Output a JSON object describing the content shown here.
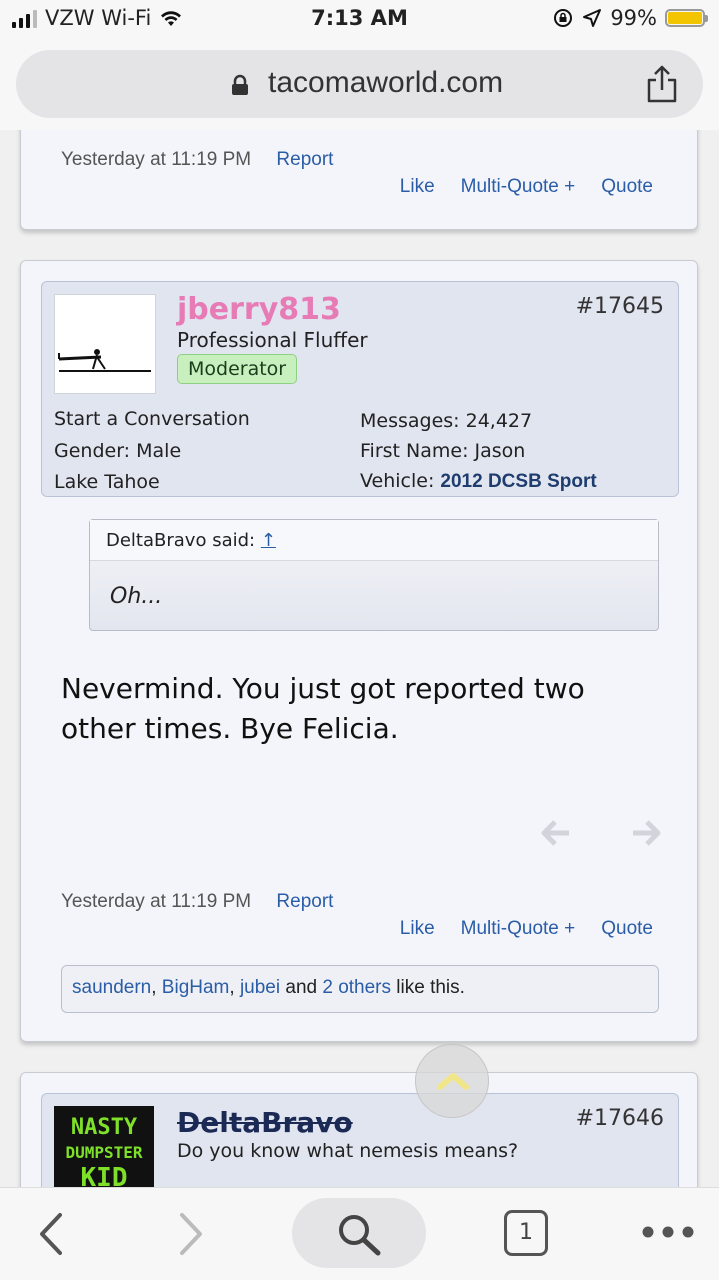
{
  "status_bar": {
    "carrier": "VZW Wi-Fi",
    "time": "7:13 AM",
    "battery": "99%",
    "battery_level": 0.99
  },
  "browser": {
    "url": "tacomaworld.com"
  },
  "prev_post": {
    "time": "Yesterday at 11:19 PM",
    "report": "Report",
    "actions": [
      "Like",
      "Multi-Quote +",
      "Quote"
    ]
  },
  "post": {
    "username": "jberry813",
    "user_title": "Professional Fluffer",
    "badge": "Moderator",
    "post_number": "#17645",
    "start_conversation": "Start a Conversation",
    "gender_label": "Gender:",
    "gender": "Male",
    "location": "Lake Tahoe",
    "messages_label": "Messages:",
    "messages": "24,427",
    "first_name_label": "First Name:",
    "first_name": "Jason",
    "vehicle_label": "Vehicle:",
    "vehicle": "2012 DCSB Sport",
    "quote": {
      "author": "DeltaBravo said:",
      "arrow": "↑",
      "text": "Oh..."
    },
    "message": "Nevermind. You just got reported two other times. Bye Felicia.",
    "time": "Yesterday at 11:19 PM",
    "report": "Report",
    "actions": [
      "Like",
      "Multi-Quote +",
      "Quote"
    ],
    "likes": {
      "user1": "saundern",
      "user2": "BigHam",
      "user3": "jubei",
      "and": "and",
      "others": "2 others",
      "suffix": "like this."
    },
    "sep": ", "
  },
  "next_post": {
    "username": "DeltaBravo",
    "post_number": "#17646",
    "signature": "Do you know what nemesis means?",
    "avatar_text": [
      "NASTY",
      "DUMPSTER",
      "KID"
    ]
  },
  "toolbar": {
    "tabs_count": "1"
  },
  "colors": {
    "link": "#2a5da6",
    "username": "#e77bb5",
    "badge_bg": "#c8f0bf",
    "avatar_green": "#7fe02a"
  }
}
